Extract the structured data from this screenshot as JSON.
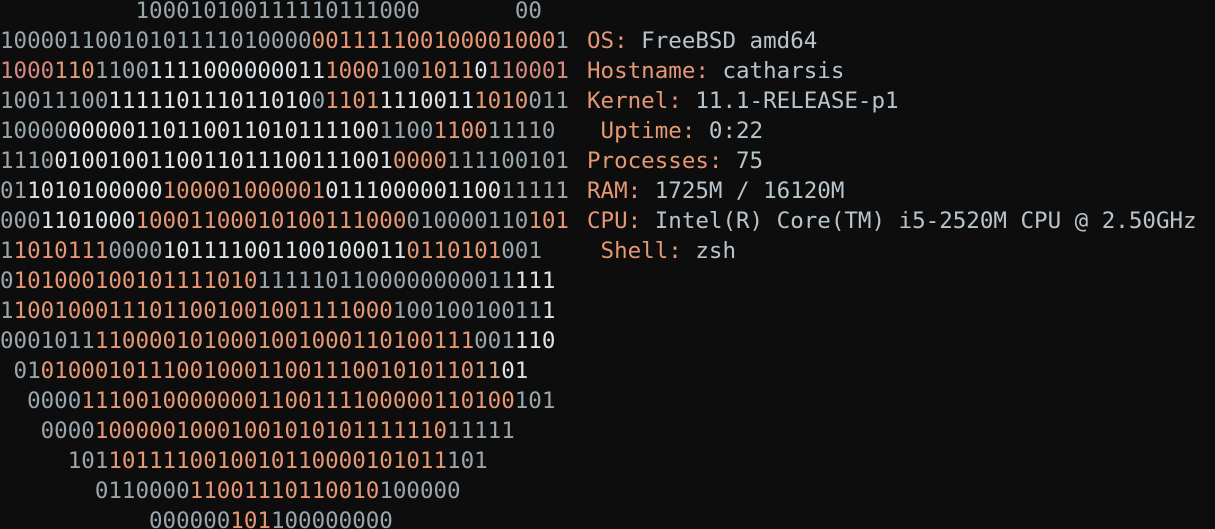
{
  "colors": {
    "background": "#0d0d0d",
    "binary_gray": "#9aa6ac",
    "binary_white": "#dde3e6",
    "binary_salmon": "#e69875",
    "binary_pink": "#d88a82",
    "binary_peach": "#d9a783",
    "label": "#e69875",
    "value": "#b8c4cc"
  },
  "art_lines": [
    {
      "indent": 5,
      "segments": [
        {
          "t": "1000101001111101110",
          "c": "binary_gray"
        },
        {
          "t": "00",
          "c": "binary_gray"
        },
        {
          "t": "       ",
          "c": "binary_gray"
        },
        {
          "t": "00",
          "c": "binary_gray"
        }
      ]
    },
    {
      "indent": 0,
      "segments": [
        {
          "t": "10000110010101111010000",
          "c": "binary_gray"
        },
        {
          "t": "001111100100001000",
          "c": "binary_salmon"
        },
        {
          "t": "1",
          "c": "binary_gray"
        }
      ]
    },
    {
      "indent": 0,
      "segments": [
        {
          "t": "1000",
          "c": "binary_pink"
        },
        {
          "t": "110",
          "c": "binary_salmon"
        },
        {
          "t": "1100",
          "c": "binary_gray"
        },
        {
          "t": "1111000000011",
          "c": "binary_white"
        },
        {
          "t": "1000",
          "c": "binary_salmon"
        },
        {
          "t": "100",
          "c": "binary_gray"
        },
        {
          "t": "1011",
          "c": "binary_salmon"
        },
        {
          "t": "0",
          "c": "binary_white"
        },
        {
          "t": "110001",
          "c": "binary_pink"
        }
      ]
    },
    {
      "indent": 0,
      "segments": [
        {
          "t": "10011100",
          "c": "binary_gray"
        },
        {
          "t": "111110111011010",
          "c": "binary_white"
        },
        {
          "t": "0",
          "c": "binary_gray"
        },
        {
          "t": "1101",
          "c": "binary_salmon"
        },
        {
          "t": "1110011",
          "c": "binary_white"
        },
        {
          "t": "1010",
          "c": "binary_salmon"
        },
        {
          "t": "011",
          "c": "binary_gray"
        }
      ]
    },
    {
      "indent": 0,
      "segments": [
        {
          "t": "10000",
          "c": "binary_gray"
        },
        {
          "t": "00000110110011010111100",
          "c": "binary_white"
        },
        {
          "t": "1100",
          "c": "binary_gray"
        },
        {
          "t": "1100",
          "c": "binary_salmon"
        },
        {
          "t": "11110",
          "c": "binary_gray"
        }
      ]
    },
    {
      "indent": 0,
      "segments": [
        {
          "t": "1110",
          "c": "binary_gray"
        },
        {
          "t": "0100100110011011100111001",
          "c": "binary_white"
        },
        {
          "t": "0000",
          "c": "binary_salmon"
        },
        {
          "t": "111100101",
          "c": "binary_gray"
        }
      ]
    },
    {
      "indent": 0,
      "segments": [
        {
          "t": "01",
          "c": "binary_gray"
        },
        {
          "t": "1010100000",
          "c": "binary_white"
        },
        {
          "t": "100001000001",
          "c": "binary_salmon"
        },
        {
          "t": "0111000001100",
          "c": "binary_white"
        },
        {
          "t": "11111",
          "c": "binary_gray"
        }
      ]
    },
    {
      "indent": 0,
      "segments": [
        {
          "t": "000",
          "c": "binary_gray"
        },
        {
          "t": "1101000",
          "c": "binary_white"
        },
        {
          "t": "10001100010100111000",
          "c": "binary_salmon"
        },
        {
          "t": "010000110",
          "c": "binary_gray"
        },
        {
          "t": "101",
          "c": "binary_salmon"
        }
      ]
    },
    {
      "indent": 0,
      "segments": [
        {
          "t": "1",
          "c": "binary_gray"
        },
        {
          "t": "1010111",
          "c": "binary_salmon"
        },
        {
          "t": "0000",
          "c": "binary_gray"
        },
        {
          "t": "101111001100100011",
          "c": "binary_white"
        },
        {
          "t": "0110101",
          "c": "binary_salmon"
        },
        {
          "t": "001",
          "c": "binary_gray"
        }
      ]
    },
    {
      "indent": 0,
      "segments": [
        {
          "t": "0",
          "c": "binary_gray"
        },
        {
          "t": "101000100101111010",
          "c": "binary_salmon"
        },
        {
          "t": "1111101100000000011",
          "c": "binary_gray"
        },
        {
          "t": "111",
          "c": "binary_white"
        }
      ]
    },
    {
      "indent": 0,
      "segments": [
        {
          "t": "1",
          "c": "binary_gray"
        },
        {
          "t": "1001000111011001001001111000",
          "c": "binary_salmon"
        },
        {
          "t": "10010010011",
          "c": "binary_gray"
        },
        {
          "t": "1",
          "c": "binary_white"
        }
      ]
    },
    {
      "indent": 0,
      "segments": [
        {
          "t": "0001011",
          "c": "binary_gray"
        },
        {
          "t": "1100001010001001000110100111",
          "c": "binary_salmon"
        },
        {
          "t": "001",
          "c": "binary_gray"
        },
        {
          "t": "110",
          "c": "binary_white"
        }
      ]
    },
    {
      "indent": 0,
      "segments": [
        {
          "t": " 01",
          "c": "binary_gray"
        },
        {
          "t": "01000101110010001100111001010110",
          "c": "binary_salmon"
        },
        {
          "t": "11",
          "c": "binary_peach"
        },
        {
          "t": "01",
          "c": "binary_white"
        }
      ]
    },
    {
      "indent": 0,
      "segments": [
        {
          "t": "  0000",
          "c": "binary_gray"
        },
        {
          "t": "11100100000001100111100000110100",
          "c": "binary_salmon"
        },
        {
          "t": "101",
          "c": "binary_gray"
        }
      ]
    },
    {
      "indent": 0,
      "segments": [
        {
          "t": "   0000",
          "c": "binary_gray"
        },
        {
          "t": "10000010001001010101111110",
          "c": "binary_salmon"
        },
        {
          "t": "11111",
          "c": "binary_gray"
        }
      ]
    },
    {
      "indent": 0,
      "segments": [
        {
          "t": "     101",
          "c": "binary_gray"
        },
        {
          "t": "1011110010010110000101011",
          "c": "binary_salmon"
        },
        {
          "t": "101",
          "c": "binary_gray"
        }
      ]
    },
    {
      "indent": 0,
      "segments": [
        {
          "t": "       0110000",
          "c": "binary_gray"
        },
        {
          "t": "11001110110010",
          "c": "binary_salmon"
        },
        {
          "t": "100000",
          "c": "binary_gray"
        }
      ]
    },
    {
      "indent": 0,
      "segments": [
        {
          "t": "           000000",
          "c": "binary_gray"
        },
        {
          "t": "101",
          "c": "binary_salmon"
        },
        {
          "t": "100000000",
          "c": "binary_gray"
        }
      ]
    }
  ],
  "info": [
    {
      "label": "OS:",
      "value": " FreeBSD amd64"
    },
    {
      "label": "Hostname:",
      "value": " catharsis"
    },
    {
      "label": "Kernel:",
      "value": " 11.1-RELEASE-p1"
    },
    {
      "label": " Uptime:",
      "value": " 0:22"
    },
    {
      "label": "Processes:",
      "value": " 75"
    },
    {
      "label": "RAM:",
      "value": " 1725M / 16120M"
    },
    {
      "label": "CPU:",
      "value": " Intel(R) Core(TM) i5-2520M CPU @ 2.50GHz"
    },
    {
      "label": " Shell:",
      "value": " zsh"
    }
  ]
}
